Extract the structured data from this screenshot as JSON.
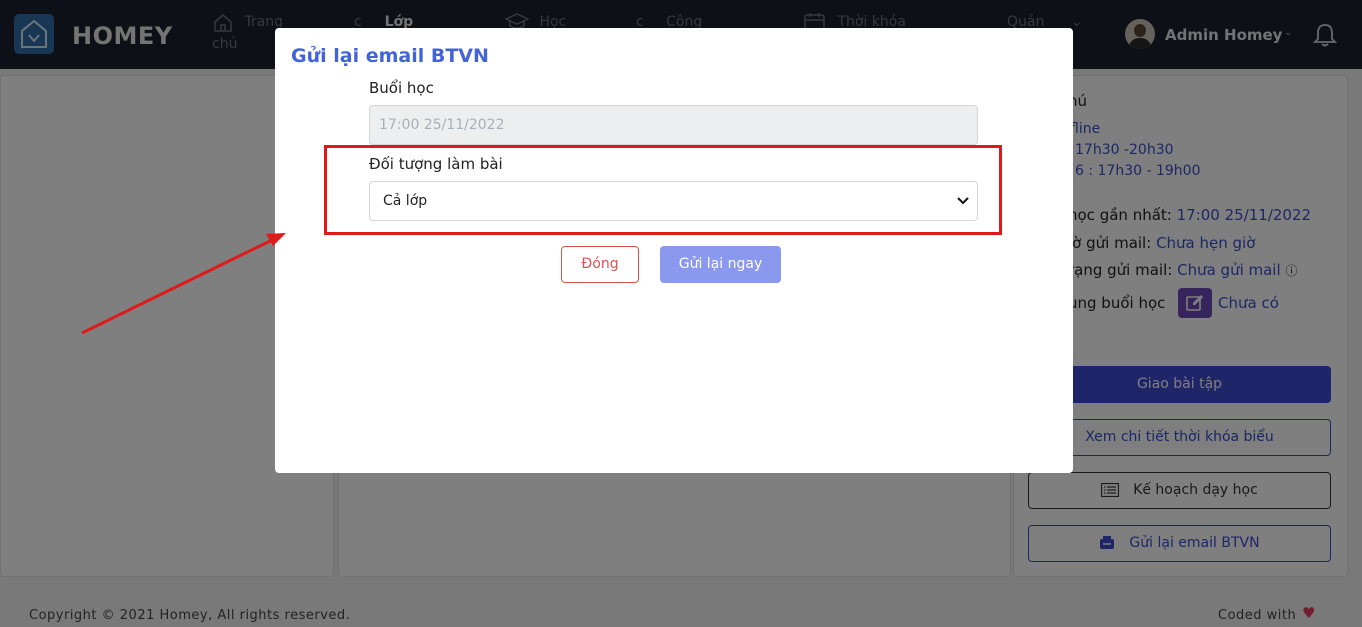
{
  "navbar": {
    "brand": "HOMEY",
    "items": [
      {
        "label_line1": "Trang",
        "label_line2": "chủ",
        "icon": "home-icon"
      },
      {
        "label_line1": "Lớp",
        "icon": "class-icon"
      },
      {
        "label_line1": "Học",
        "icon": "graduation-cap-icon"
      },
      {
        "label_line1": "Công",
        "icon": "work-icon"
      },
      {
        "label_line1": "Thời khóa",
        "icon": "calendar-icon"
      },
      {
        "label_line1": "Quản",
        "icon": "manage-icon"
      }
    ],
    "user_name": "Admin Homey"
  },
  "right_panel": {
    "partial_note_title": "hú",
    "partial_mode": "fline",
    "partial_schedule_1": "17h30 -20h30",
    "partial_schedule_2": "6 : 17h30 - 19h00",
    "nearest_session_label": "học gần nhất:",
    "nearest_session_value": "17:00 25/11/2022",
    "mail_time_label": "iờ gửi mail:",
    "mail_time_value": "Chưa hẹn giờ",
    "mail_status_label": "rạng gửi mail:",
    "mail_status_value": "Chưa gửi mail",
    "session_content_label": "ung buổi học",
    "session_content_value": "Chưa có",
    "buttons": {
      "assign": "Giao bài tập",
      "view_timetable": "Xem chi tiết thời khóa biểu",
      "teaching_plan": "Kế hoạch dạy học",
      "resend_email": "Gửi lại email BTVN"
    }
  },
  "footer": {
    "copyright": "Copyright © 2021 Homey, All rights reserved.",
    "coded_with": "Coded with"
  },
  "modal": {
    "title": "Gửi lại email BTVN",
    "session_label": "Buổi học",
    "session_value": "17:00 25/11/2022",
    "target_label": "Đối tượng làm bài",
    "target_selected": "Cả lớp",
    "close_button": "Đóng",
    "send_button": "Gửi lại ngay"
  },
  "colors": {
    "accent": "#4364d8",
    "primary_button": "#3c4bd0",
    "danger": "#d9534f",
    "annotation": "#e01919"
  }
}
